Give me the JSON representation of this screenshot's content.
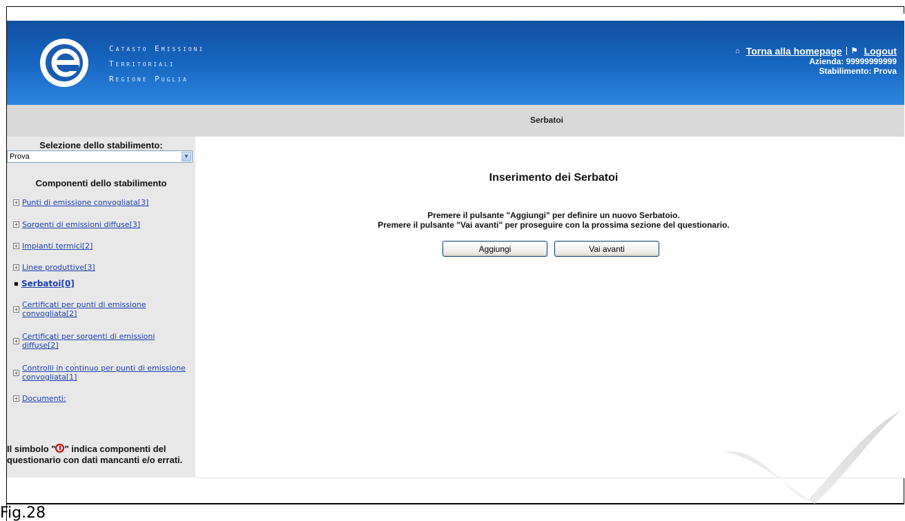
{
  "header": {
    "brand_lines": [
      "Catasto Emissioni",
      "Territoriali",
      "Regione Puglia"
    ],
    "homepage_link": "Torna alla homepage",
    "logout_link": "Logout",
    "azienda": "Azienda: 99999999999",
    "stabilimento": "Stabilimento: Prova",
    "colors": {
      "header_top": "#0e4c9a",
      "header_bottom": "#2e86e0"
    }
  },
  "titlebar": {
    "title": "Serbatoi"
  },
  "sidebar": {
    "select_label": "Selezione dello stabilimento:",
    "select_value": "Prova",
    "components_title": "Componenti dello stabilimento",
    "items": [
      {
        "label": "Punti di emissione convogliata[3]"
      },
      {
        "label": "Sorgenti di emissioni diffuse[3]"
      },
      {
        "label": "Impianti termici[2]"
      },
      {
        "label": "Linee produttive[3]"
      },
      {
        "label": "Serbatoi[0]",
        "active": true
      },
      {
        "label": "Certificati per punti di emissione convogliata[2]"
      },
      {
        "label": "Certificati per sorgenti di emissioni diffuse[2]"
      },
      {
        "label": "Controlli in continuo per punti di emissione convogliata[1]"
      },
      {
        "label": "Documenti:"
      }
    ],
    "note_prefix": "Il simbolo \"",
    "note_suffix": "\" indica componenti del questionario con dati mancanti e/o errati."
  },
  "main": {
    "title": "Inserimento dei Serbatoi",
    "instruction_1": "Premere il pulsante \"Aggiungi\" per definire un nuovo Serbatoio.",
    "instruction_2": "Premere il pulsante \"Vai avanti\" per proseguire con la prossima sezione del questionario.",
    "add_button": "Aggiungi",
    "next_button": "Vai avanti"
  },
  "caption": "Fig.28"
}
